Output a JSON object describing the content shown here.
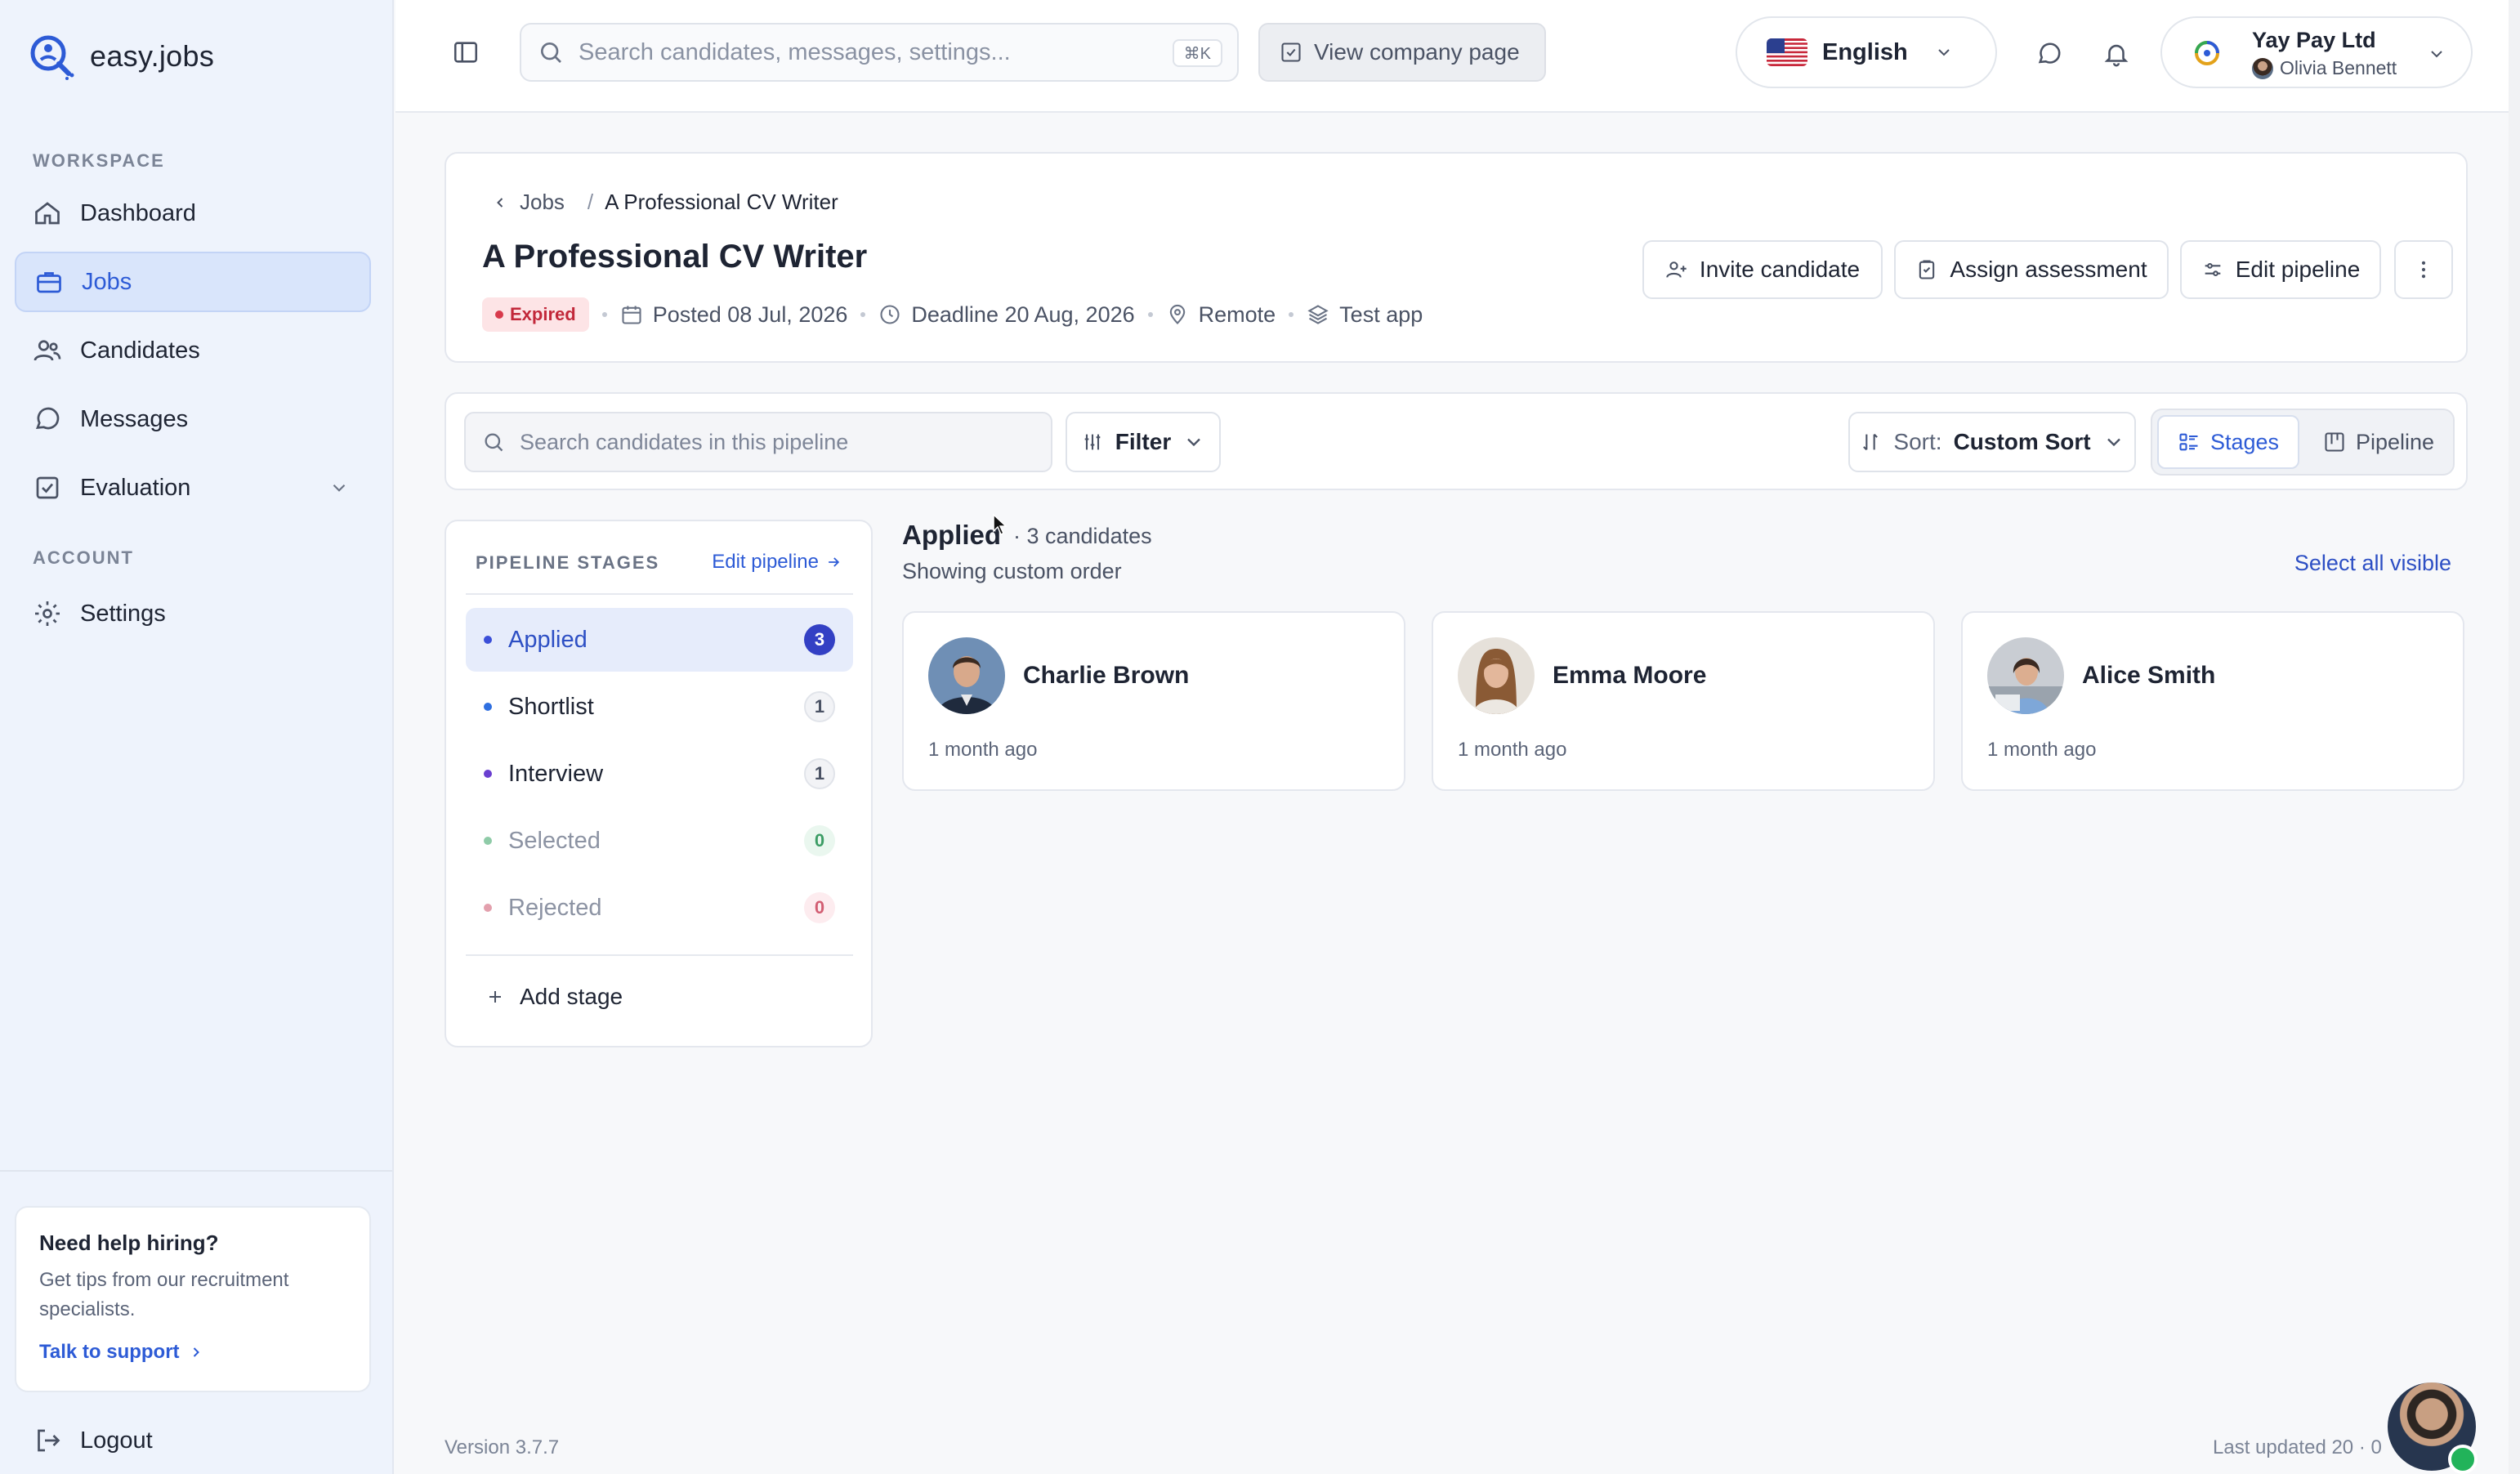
{
  "app": {
    "name": "easy.jobs"
  },
  "sidebar": {
    "workspace_label": "WORKSPACE",
    "account_label": "ACCOUNT",
    "items": [
      {
        "label": "Dashboard"
      },
      {
        "label": "Jobs"
      },
      {
        "label": "Candidates"
      },
      {
        "label": "Messages"
      },
      {
        "label": "Evaluation"
      },
      {
        "label": "Settings"
      }
    ],
    "help": {
      "title": "Need help hiring?",
      "text": "Get tips from our recruitment specialists.",
      "link": "Talk to support"
    },
    "logout": "Logout"
  },
  "topbar": {
    "search_placeholder": "Search candidates, messages, settings...",
    "shortcut": "⌘K",
    "view_company": "View company page",
    "language": "English",
    "company": "Yay Pay Ltd",
    "user": "Olivia Bennett"
  },
  "job": {
    "breadcrumb_parent": "Jobs",
    "breadcrumb_sep": "/",
    "breadcrumb_current": "A Professional CV Writer",
    "title": "A Professional CV Writer",
    "status": "Expired",
    "posted": "Posted 08 Jul, 2026",
    "deadline": "Deadline 20 Aug, 2026",
    "location": "Remote",
    "app": "Test app",
    "actions": {
      "invite": "Invite candidate",
      "assess": "Assign assessment",
      "edit_pipeline": "Edit pipeline"
    }
  },
  "toolbar": {
    "search_placeholder": "Search candidates in this pipeline",
    "filter": "Filter",
    "sort_label": "Sort:",
    "sort_value": "Custom Sort",
    "view_stages": "Stages",
    "view_pipeline": "Pipeline"
  },
  "stages": {
    "heading": "PIPELINE STAGES",
    "edit": "Edit pipeline",
    "items": [
      {
        "name": "Applied",
        "count": "3",
        "color": "#3b4fd8"
      },
      {
        "name": "Shortlist",
        "count": "1",
        "color": "#2f6fe0"
      },
      {
        "name": "Interview",
        "count": "1",
        "color": "#6a3fd0"
      },
      {
        "name": "Selected",
        "count": "0",
        "color": "#4ab27a"
      },
      {
        "name": "Rejected",
        "count": "0",
        "color": "#d9647a"
      }
    ],
    "add": "Add stage"
  },
  "board": {
    "title": "Applied",
    "count_text": "· 3 candidates",
    "subtitle": "Showing custom order",
    "select_all": "Select all visible",
    "candidates": [
      {
        "name": "Charlie Brown",
        "time": "1 month ago"
      },
      {
        "name": "Emma Moore",
        "time": "1 month ago"
      },
      {
        "name": "Alice Smith",
        "time": "1 month ago"
      }
    ]
  },
  "footer": {
    "version": "Version 3.7.7",
    "updated": "Last updated 20 · 0"
  },
  "colors": {
    "accent": "#2d5bd6",
    "danger": "#c2283a",
    "sidebar_bg": "#eef3fc"
  }
}
